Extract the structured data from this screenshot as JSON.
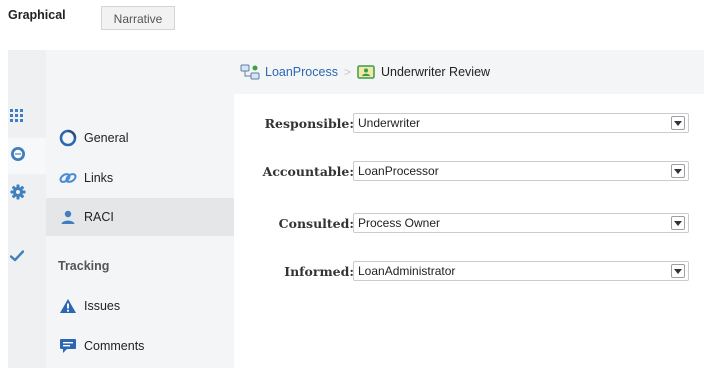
{
  "tabs": {
    "graphical": "Graphical",
    "narrative": "Narrative"
  },
  "rail": {
    "icons": [
      "grid-icon",
      "comment-icon",
      "gear-icon",
      "check-icon"
    ],
    "active": "comment-icon"
  },
  "nav": {
    "general": "General",
    "links": "Links",
    "raci": "RACI",
    "tracking_header": "Tracking",
    "issues": "Issues",
    "comments": "Comments",
    "selected": "RACI"
  },
  "breadcrumb": {
    "process": "LoanProcess",
    "activity": "Underwriter Review"
  },
  "raci": {
    "responsible_label": "Responsible:",
    "responsible_value": "Underwriter",
    "accountable_label": "Accountable:",
    "accountable_value": "LoanProcessor",
    "consulted_label": "Consulted:",
    "consulted_value": "Process Owner",
    "informed_label": "Informed:",
    "informed_value": "LoanAdministrator"
  },
  "colors": {
    "link": "#2b67b3",
    "rail_icon": "#3f7fbf",
    "panel_bg": "#f4f5f6",
    "selected_bg": "#e4e6e8"
  }
}
